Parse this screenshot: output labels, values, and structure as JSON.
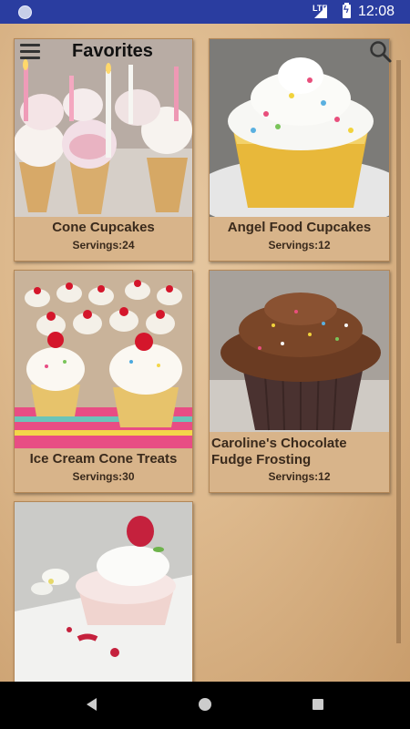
{
  "status_bar": {
    "network": "LTE",
    "time": "12:08"
  },
  "header": {
    "title": "Favorites"
  },
  "recipes": [
    {
      "name": "Cone Cupcakes",
      "servings": "Servings:24"
    },
    {
      "name": "Angel Food Cupcakes",
      "servings": "Servings:12"
    },
    {
      "name": "Ice Cream Cone Treats",
      "servings": "Servings:30"
    },
    {
      "name": "Caroline's Chocolate Fudge Frosting",
      "servings": "Servings:12"
    },
    {
      "name": "",
      "servings": ""
    }
  ],
  "icons": {
    "menu": "hamburger-menu-icon",
    "search": "search-icon",
    "back": "back-icon",
    "home": "home-icon",
    "recents": "recents-icon"
  }
}
